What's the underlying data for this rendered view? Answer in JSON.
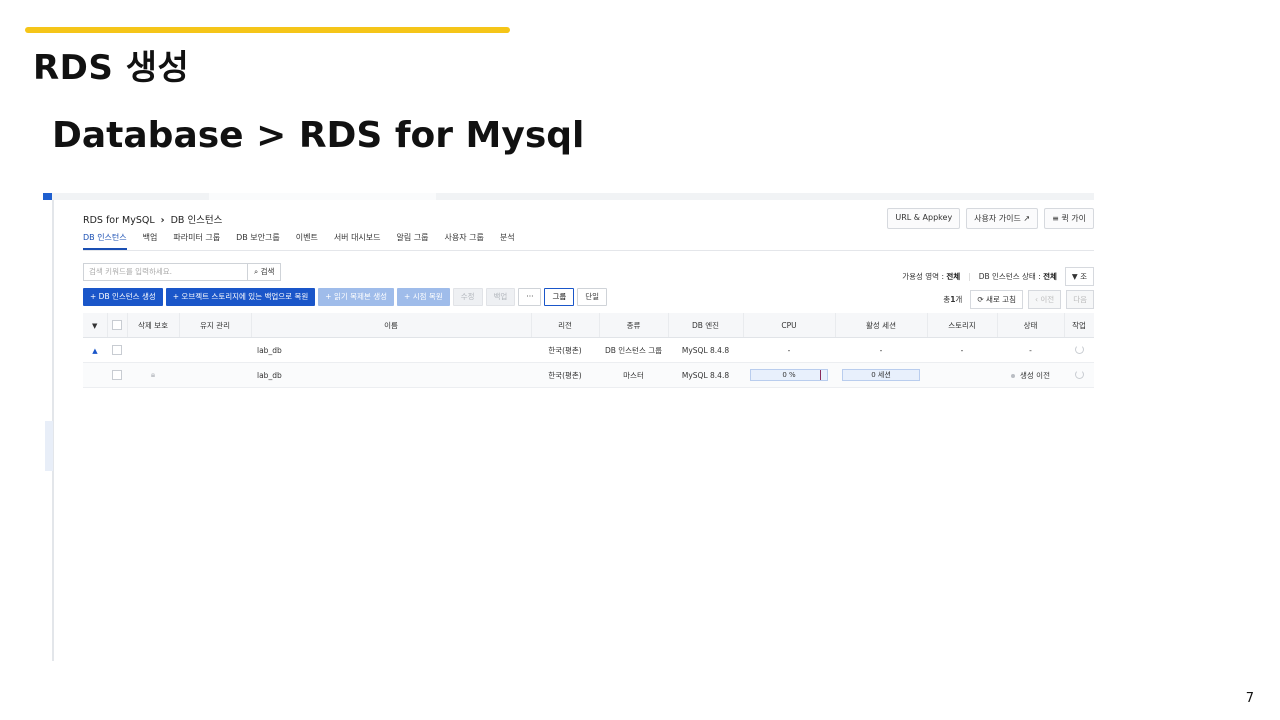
{
  "slide": {
    "title": "RDS 생성",
    "subtitle": "Database > RDS for Mysql",
    "page_number": "7",
    "accent_color": "#f5c518"
  },
  "console": {
    "breadcrumb": {
      "service": "RDS for MySQL",
      "page": "DB 인스턴스"
    },
    "top_buttons": {
      "url_appkey": "URL & Appkey",
      "user_guide": "사용자 가이드",
      "quick_guide": "퀵 가이"
    },
    "tabs": [
      "DB 인스턴스",
      "백업",
      "파라미터 그룹",
      "DB 보안그룹",
      "이벤트",
      "서버 대시보드",
      "알림 그룹",
      "사용자 그룹",
      "분석"
    ],
    "search": {
      "placeholder": "검색 키워드를 입력하세요.",
      "button": "검색"
    },
    "filters": {
      "availability_label": "가용성 영역 :",
      "availability_value": "전체",
      "status_label": "DB 인스턴스 상태 :",
      "status_value": "전체",
      "filter_button": "조"
    },
    "actions": {
      "create": "+ DB 인스턴스 생성",
      "restore": "+ 오브젝트 스토리지에 있는 백업으로 복원",
      "replica": "+ 읽기 복제본 생성",
      "pitr": "+ 시점 복원",
      "edit": "수정",
      "backup": "백업",
      "more": "···",
      "group_view": "그룹",
      "single_view": "단일"
    },
    "pager": {
      "total_prefix": "총",
      "total_count": "1",
      "total_suffix": "개",
      "refresh": "새로 고침",
      "prev": "이전",
      "next": "다음"
    },
    "table": {
      "headers": [
        "삭제 보호",
        "유지 관리",
        "이름",
        "리전",
        "종류",
        "DB 엔진",
        "CPU",
        "활성 세션",
        "스토리지",
        "상태",
        "작업"
      ],
      "group_row": {
        "name": "lab_db",
        "region": "한국(평촌)",
        "type": "DB 인스턴스 그룹",
        "engine": "MySQL 8.4.8",
        "cpu": "-",
        "sessions": "-",
        "storage": "-",
        "status": "-"
      },
      "instance_row": {
        "name": "lab_db",
        "region": "한국(평촌)",
        "type": "마스터",
        "engine": "MySQL 8.4.8",
        "cpu": "0 %",
        "cpu_fraction": 0.0,
        "sessions": "0 세션",
        "storage": "",
        "status": "생성 이전"
      }
    }
  }
}
